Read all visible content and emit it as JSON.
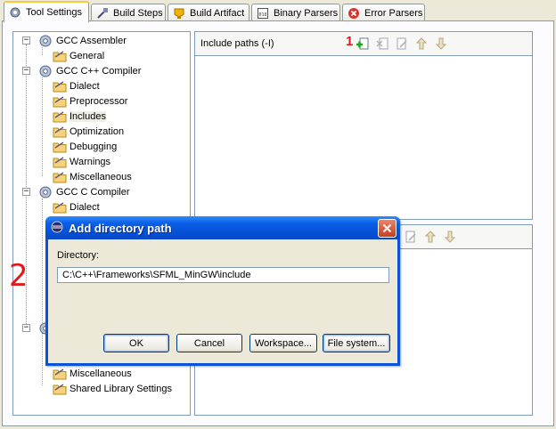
{
  "tabs": [
    {
      "label": "Tool Settings",
      "icon": "gear-tool-icon",
      "active": true
    },
    {
      "label": "Build Steps",
      "icon": "build-steps-icon"
    },
    {
      "label": "Build Artifact",
      "icon": "build-artifact-icon"
    },
    {
      "label": "Binary Parsers",
      "icon": "binary-parsers-icon"
    },
    {
      "label": "Error Parsers",
      "icon": "error-parsers-icon"
    }
  ],
  "tree": {
    "items": [
      {
        "label": "GCC Assembler",
        "kind": "tool"
      },
      {
        "label": "General",
        "kind": "option"
      },
      {
        "label": "GCC C++ Compiler",
        "kind": "tool"
      },
      {
        "label": "Dialect",
        "kind": "option"
      },
      {
        "label": "Preprocessor",
        "kind": "option"
      },
      {
        "label": "Includes",
        "kind": "option",
        "selected": true
      },
      {
        "label": "Optimization",
        "kind": "option"
      },
      {
        "label": "Debugging",
        "kind": "option"
      },
      {
        "label": "Warnings",
        "kind": "option"
      },
      {
        "label": "Miscellaneous",
        "kind": "option"
      },
      {
        "label": "GCC C Compiler",
        "kind": "tool"
      },
      {
        "label": "Dialect",
        "kind": "option"
      },
      {
        "label": "Miscellaneous",
        "kind": "option"
      },
      {
        "label": "Shared Library Settings",
        "kind": "option"
      }
    ]
  },
  "include_paths": {
    "title": "Include paths (-I)"
  },
  "dialog": {
    "title": "Add directory path",
    "directory_label": "Directory:",
    "directory_value": "C:\\C++\\Frameworks\\SFML_MinGW\\include",
    "buttons": {
      "ok": "OK",
      "cancel": "Cancel",
      "workspace": "Workspace...",
      "file_system": "File system..."
    }
  },
  "annotations": {
    "one": "1",
    "two": "2"
  },
  "colors": {
    "xp_title_blue": "#0451d6",
    "annotation_red": "#e01a1a",
    "window_bg": "#ece9d8"
  }
}
